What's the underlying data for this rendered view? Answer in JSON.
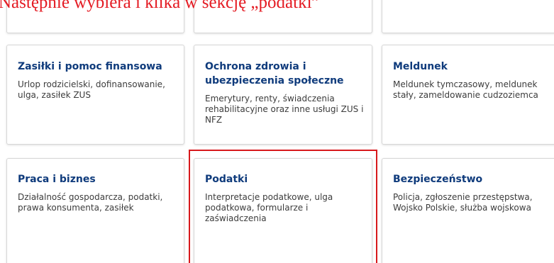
{
  "caption": "Następnie wybiera i klika w sekcję „podatki”",
  "colors": {
    "caption": "#e41b23",
    "card_title": "#0f3b7c",
    "card_text": "#3c3c3c",
    "card_border": "#d7d7d7",
    "highlight": "#d7191c"
  },
  "cards": [
    {
      "title": "Zasiłki i pomoc finansowa",
      "description": "Urlop rodzicielski, dofinansowanie, ulga, zasiłek ZUS"
    },
    {
      "title": "Ochrona zdrowia i ubezpieczenia społeczne",
      "description": "Emerytury, renty, świadczenia rehabilitacyjne oraz inne usługi ZUS i NFZ"
    },
    {
      "title": "Meldunek",
      "description": "Meldunek tymczasowy, meldunek stały, zameldowanie cudzoziemca"
    },
    {
      "title": "Praca i biznes",
      "description": "Działalność gospodarcza, podatki, prawa konsumenta, zasiłek"
    },
    {
      "title": "Podatki",
      "description": "Interpretacje podatkowe, ulga podatkowa, formularze i zaświadczenia",
      "highlighted": true
    },
    {
      "title": "Bezpieczeństwo",
      "description": "Policja, zgłoszenie przestępstwa, Wojsko Polskie, służba wojskowa"
    }
  ]
}
